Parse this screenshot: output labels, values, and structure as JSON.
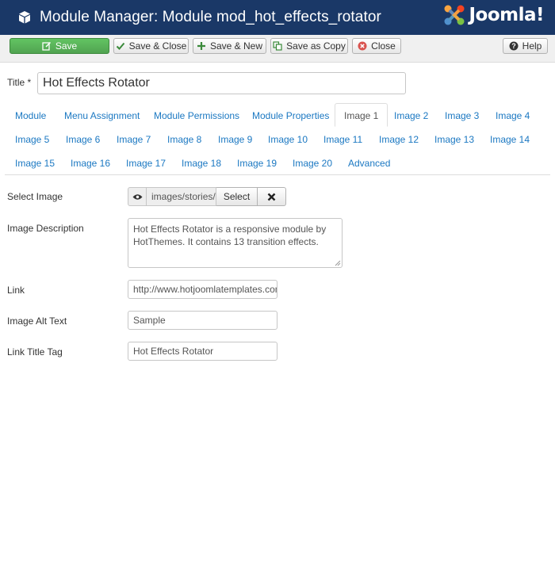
{
  "header": {
    "title": "Module Manager: Module mod_hot_effects_rotator",
    "logo_text": "Joomla!"
  },
  "toolbar": {
    "save": "Save",
    "save_close": "Save & Close",
    "save_new": "Save & New",
    "save_copy": "Save as Copy",
    "close": "Close",
    "help": "Help"
  },
  "title_field": {
    "label": "Title *",
    "value": "Hot Effects Rotator"
  },
  "tabs": [
    "Module",
    "Menu Assignment",
    "Module Permissions",
    "Module Properties",
    "Image 1",
    "Image 2",
    "Image 3",
    "Image 4",
    "Image 5",
    "Image 6",
    "Image 7",
    "Image 8",
    "Image 9",
    "Image 10",
    "Image 11",
    "Image 12",
    "Image 13",
    "Image 14",
    "Image 15",
    "Image 16",
    "Image 17",
    "Image 18",
    "Image 19",
    "Image 20",
    "Advanced"
  ],
  "active_tab": "Image 1",
  "form": {
    "select_image_label": "Select Image",
    "image_path": "images/stories/",
    "select_button": "Select",
    "description_label": "Image Description",
    "description_value": "Hot Effects Rotator is a responsive module by HotThemes. It contains 13 transition effects.",
    "link_label": "Link",
    "link_value": "http://www.hotjoomlatemplates.com",
    "alt_label": "Image Alt Text",
    "alt_value": "Sample",
    "title_tag_label": "Link Title Tag",
    "title_tag_value": "Hot Effects Rotator"
  },
  "colors": {
    "header_bg": "#1a3867",
    "save_green": "#51a351",
    "link_blue": "#1b78c2",
    "close_red": "#d9534f"
  }
}
